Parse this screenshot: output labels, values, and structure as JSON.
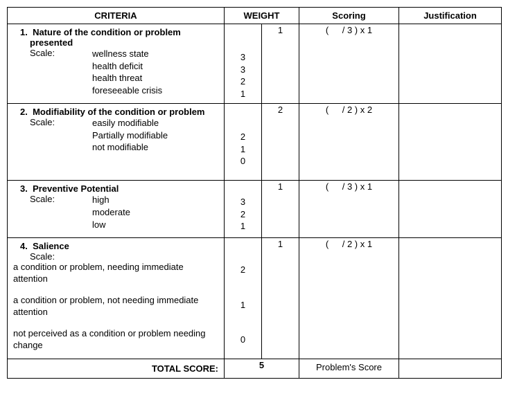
{
  "headers": {
    "criteria": "CRITERIA",
    "weight": "WEIGHT",
    "scoring": "Scoring",
    "justification": "Justification"
  },
  "scale_label": "Scale:",
  "rows": [
    {
      "num": "1.",
      "title": "Nature of the condition or problem presented",
      "items": [
        "wellness state",
        "health deficit",
        "health threat",
        "foreseeable crisis"
      ],
      "item_weights": [
        "3",
        "3",
        "2",
        "1"
      ],
      "weight_spacer_lines": 2,
      "multiplier": "1",
      "scoring": "(  / 3 ) x 1"
    },
    {
      "num": "2.",
      "title": "Modifiability of the condition or problem",
      "items": [
        "easily modifiable",
        "Partially modifiable",
        "not modifiable"
      ],
      "item_weights": [
        "2",
        "1",
        "0",
        ""
      ],
      "weight_spacer_lines": 2,
      "multiplier": "2",
      "scoring": "(  / 2 ) x 2"
    },
    {
      "num": "3.",
      "title": "Preventive Potential",
      "items": [
        "high",
        "moderate",
        "low"
      ],
      "item_weights": [
        "3",
        "2",
        "1"
      ],
      "weight_spacer_lines": 1,
      "multiplier": "1",
      "scoring": "(  / 3 ) x 1"
    }
  ],
  "salience": {
    "num": "4.",
    "title": "Salience",
    "lines": [
      "a condition or problem, needing immediate attention",
      "a condition or problem, not needing immediate attention",
      "not perceived as a condition or problem needing change"
    ],
    "weights_col": " \n \n2\n \n \n1\n \n \n0\n ",
    "multiplier": "1",
    "scoring": "(  / 2 ) x 1"
  },
  "total": {
    "label": "TOTAL SCORE:",
    "value": "5",
    "problem_score": "Problem's Score"
  }
}
